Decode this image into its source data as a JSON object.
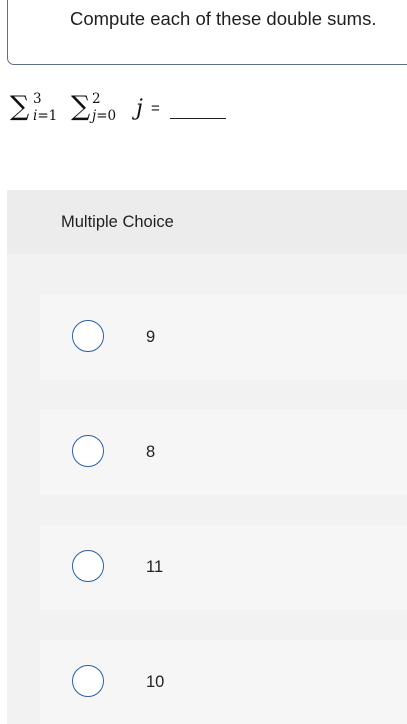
{
  "question": {
    "prompt": "Compute each of these double sums.",
    "expression": {
      "outer_sigma": "∑",
      "outer_upper": "3",
      "outer_index": "i",
      "outer_lower": "=1",
      "inner_sigma": "∑",
      "inner_upper": "2",
      "inner_index": "j",
      "inner_lower": "=0",
      "term": "j",
      "equals": "="
    }
  },
  "multiple_choice": {
    "title": "Multiple Choice",
    "options": [
      {
        "label": "9",
        "selected": false
      },
      {
        "label": "8",
        "selected": false
      },
      {
        "label": "11",
        "selected": false
      },
      {
        "label": "10",
        "selected": false
      }
    ]
  },
  "colors": {
    "radio_border": "#2b5f9e",
    "panel_background": "#f2f2f2",
    "prompt_border": "#5b6f86"
  }
}
